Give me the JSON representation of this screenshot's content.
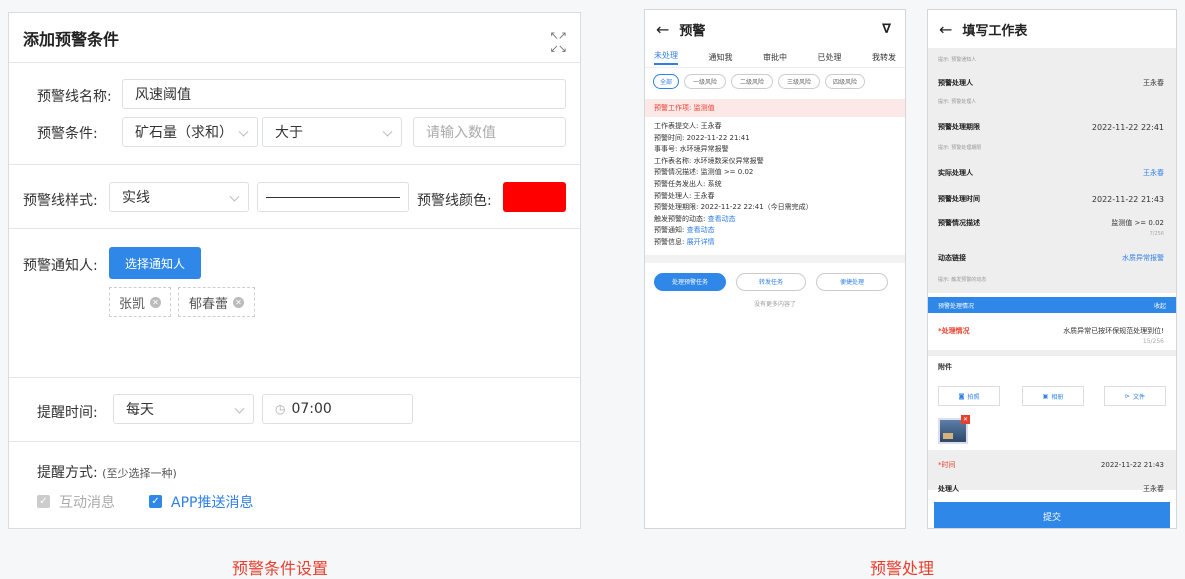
{
  "left_panel": {
    "title": "添加预警条件",
    "name_label": "预警线名称:",
    "name_value": "风速阈值",
    "cond_label": "预警条件:",
    "cond_field": "矿石量（求和）",
    "cond_op": "大于",
    "cond_placeholder": "请输入数值",
    "style_label": "预警线样式:",
    "style_value": "实线",
    "color_label": "预警线颜色:",
    "line_color": "#ff0000",
    "notify_label": "预警通知人:",
    "notify_button": "选择通知人",
    "notify_tags": [
      "张凯",
      "郁春蕾"
    ],
    "remind_label": "提醒时间:",
    "remind_freq": "每天",
    "remind_time": "07:00",
    "method_label": "提醒方式:",
    "method_hint": "(至少选择一种)",
    "method_options": [
      "互动消息",
      "APP推送消息"
    ]
  },
  "captions": {
    "left": "预警条件设置",
    "right": "预警处理"
  },
  "phone1": {
    "title": "预警",
    "tabs": [
      "未处理",
      "通知我",
      "审批中",
      "已处理",
      "我转发"
    ],
    "pills": [
      "全部",
      "一级风险",
      "二级风险",
      "三级风险",
      "四级风险"
    ],
    "warn_title": "预警工作项: 监测值",
    "info": [
      {
        "k": "工作表提交人: ",
        "v": "王永春"
      },
      {
        "k": "预警时间: ",
        "v": "2022-11-22 21:41"
      },
      {
        "k": "事事号: ",
        "v": "水环境异常报警"
      },
      {
        "k": "工作表名称: ",
        "v": "水环境数采仪异常报警"
      },
      {
        "k": "预警情况描述: ",
        "v": "监测值 >= 0.02"
      },
      {
        "k": "预警任务发出人: ",
        "v": "系统"
      },
      {
        "k": "预警处理人: ",
        "v": "王永春"
      },
      {
        "k": "预警处理期限: ",
        "v": "2022-11-22 22:41（今日需完成）"
      }
    ],
    "links": [
      {
        "k": "触发预警的动态: ",
        "v": "查看动态"
      },
      {
        "k": "预警通知: ",
        "v": "查看动态"
      },
      {
        "k": "预警信息: ",
        "v": "展开详情"
      }
    ],
    "buttons": [
      "处理预警任务",
      "转发任务",
      "便捷处理"
    ],
    "no_more": "没有更多内容了"
  },
  "phone2": {
    "title": "填写工作表",
    "hint_top": "提示: 预警通知人",
    "rows": [
      {
        "label": "预警处理人",
        "value": "王永春",
        "hint": "提示: 预警处理人"
      },
      {
        "label": "预警处理期限",
        "value": "2022-11-22 22:41",
        "hint": "提示: 预警处理期限"
      },
      {
        "label": "实际处理人",
        "value": "王永春",
        "hint": ""
      },
      {
        "label": "预警处理时间",
        "value": "2022-11-22 21:43",
        "hint": ""
      },
      {
        "label": "预警情况描述",
        "value": "监测值 >= 0.02",
        "hint": ""
      },
      {
        "label": "动态链接",
        "value": "水质异常报警",
        "hint": "提示: 触发预警的动态"
      }
    ],
    "counter1": "7/256",
    "section": "预警处理情况",
    "section_right": "收起",
    "process_label": "*处理情况",
    "process_value": "水质异常已按环保规范处理到位!",
    "counter2": "15/256",
    "attach_label": "附件",
    "attach_buttons": [
      "拍照",
      "相册",
      "文件"
    ],
    "time_label": "*时间",
    "time_value": "2022-11-22 21:43",
    "handler_label": "处理人",
    "handler_value": "王永春",
    "submit": "提交"
  }
}
